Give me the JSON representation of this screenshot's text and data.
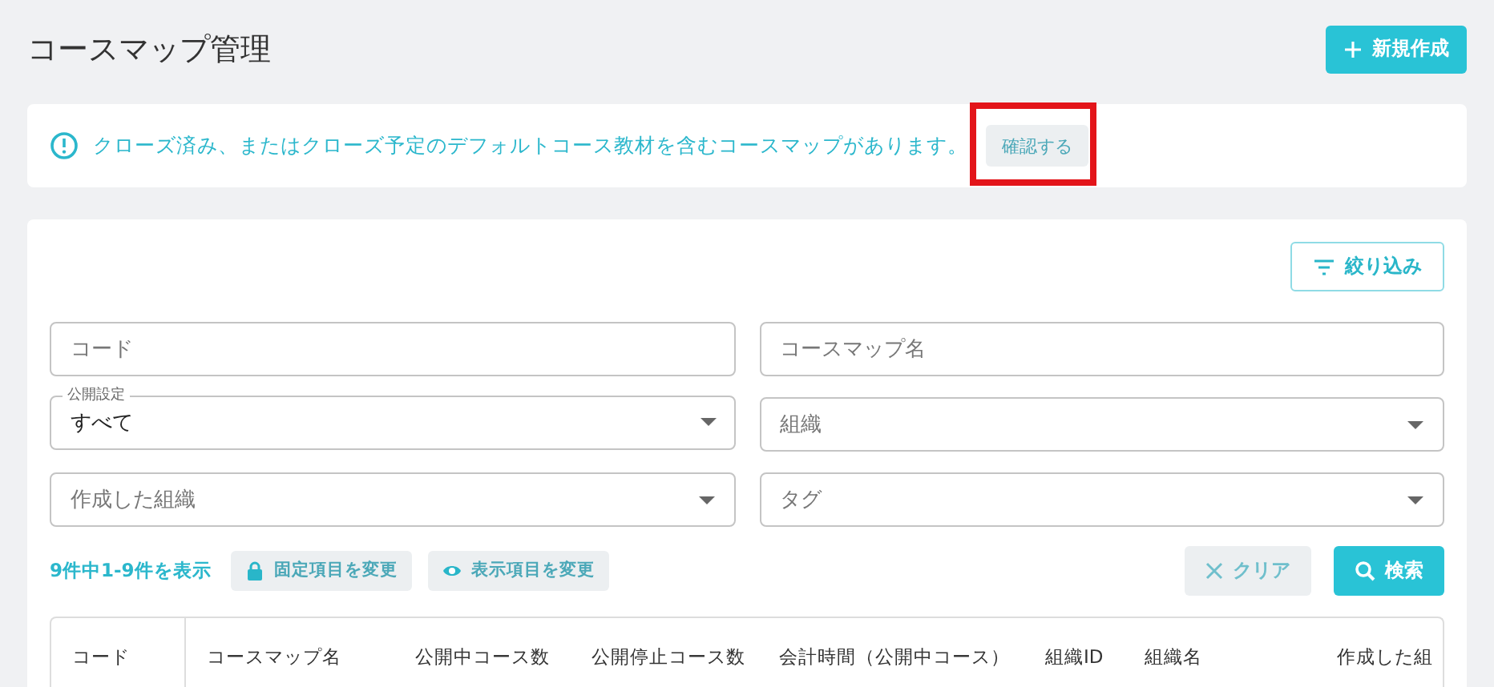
{
  "page_title": "コースマップ管理",
  "new_button": {
    "label": "新規作成"
  },
  "alert": {
    "message": "クローズ済み、またはクローズ予定のデフォルトコース教材を含むコースマップがあります。",
    "button": {
      "label": "確認する",
      "highlighted": true
    }
  },
  "filter_button": {
    "label": "絞り込み"
  },
  "fields": [
    {
      "kind": "text",
      "placeholder": "コード"
    },
    {
      "kind": "text",
      "placeholder": "コースマップ名"
    },
    {
      "kind": "select",
      "label": "公開設定",
      "value": "すべて"
    },
    {
      "kind": "select",
      "placeholder": "組織"
    },
    {
      "kind": "select",
      "placeholder": "作成した組織"
    },
    {
      "kind": "select",
      "placeholder": "タグ"
    }
  ],
  "result_count": "9件中1-9件を表示",
  "toolbar_buttons": [
    {
      "kind": "lock",
      "label": "固定項目を変更"
    },
    {
      "kind": "eye",
      "label": "表示項目を変更"
    }
  ],
  "clear_button": {
    "label": "クリア"
  },
  "search_button": {
    "label": "検索"
  },
  "table": {
    "columns": [
      "コード",
      "コースマップ名",
      "公開中コース数",
      "公開停止コース数",
      "会計時間（公開中コース）",
      "組織ID",
      "組織名",
      "作成した組"
    ]
  }
}
